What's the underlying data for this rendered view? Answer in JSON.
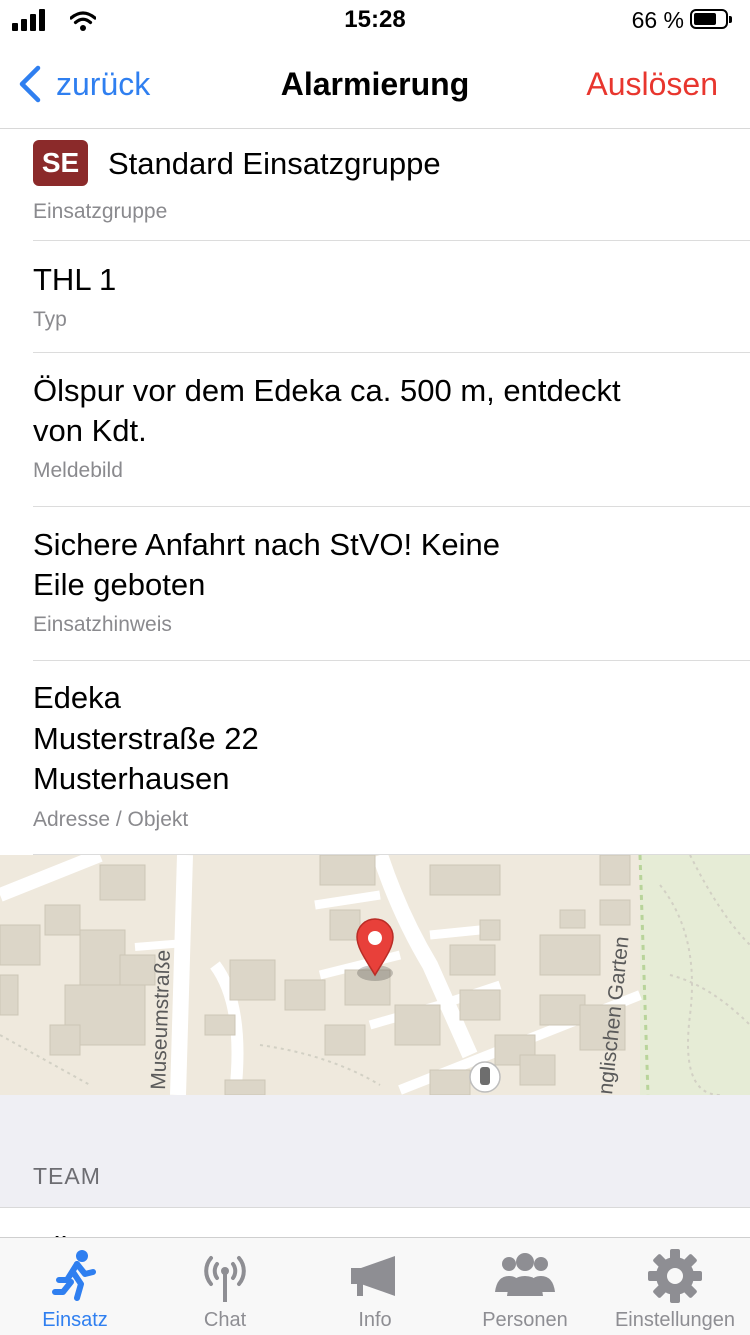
{
  "status": {
    "time": "15:28",
    "battery_text": "66 %"
  },
  "nav": {
    "back_label": "zurück",
    "title": "Alarmierung",
    "action_label": "Auslösen"
  },
  "group": {
    "badge": "SE",
    "name": "Standard Einsatzgruppe",
    "label": "Einsatzgruppe"
  },
  "type": {
    "value": "THL 1",
    "label": "Typ"
  },
  "report": {
    "line1": "Ölspur vor dem Edeka ca. 500 m, entdeckt",
    "line2": "von Kdt.",
    "label": "Meldebild"
  },
  "hint": {
    "line1": "Sichere Anfahrt nach StVO! Keine",
    "line2": "Eile geboten",
    "label": "Einsatzhinweis"
  },
  "address": {
    "line1": "Edeka",
    "line2": "Musterstraße 22",
    "line3": "Musterhausen",
    "label": "Adresse / Objekt"
  },
  "map": {
    "street1": "Museumstraße",
    "street2": "nglischen Garten"
  },
  "team": {
    "header": "TEAM",
    "first_item": "Alle P..."
  },
  "tabs": [
    {
      "label": "Einsatz",
      "icon": "running-person-icon"
    },
    {
      "label": "Chat",
      "icon": "radio-tower-icon"
    },
    {
      "label": "Info",
      "icon": "megaphone-icon"
    },
    {
      "label": "Personen",
      "icon": "people-icon"
    },
    {
      "label": "Einstellungen",
      "icon": "gear-icon"
    }
  ],
  "colors": {
    "accent": "#2f7ff0",
    "danger": "#e8362e",
    "badge": "#8b2a2a",
    "map_pin": "#e8403a"
  }
}
